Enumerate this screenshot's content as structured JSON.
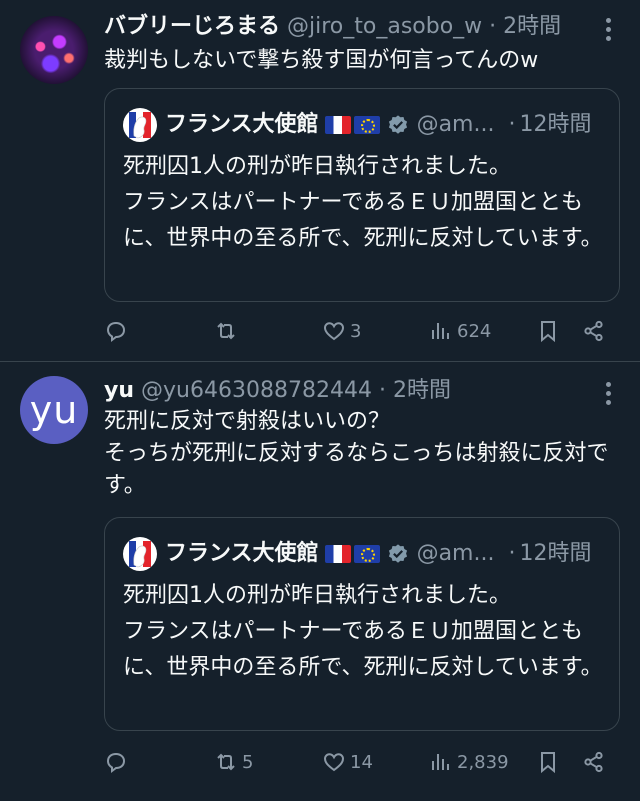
{
  "tweets": [
    {
      "display_name": "バブリーじろまる",
      "handle": "@jiro_to_asobo_w",
      "time": "2時間",
      "text": "裁判もしないで撃ち殺す国が何言ってんのw",
      "quote": {
        "name": "フランス大使館",
        "handle": "@am...",
        "time": "12時間",
        "text": "死刑囚1人の刑が昨日執行されました。\nフランスはパートナーであるＥＵ加盟国とともに、世界中の至る所で、死刑に反対しています。"
      },
      "replies": "",
      "retweets": "",
      "likes": "3",
      "views": "624"
    },
    {
      "avatar_text": "yu",
      "display_name": "yu",
      "handle": "@yu6463088782444",
      "time": "2時間",
      "text": "死刑に反対で射殺はいいの？\nそっちが死刑に反対するならこっちは射殺に反対です。",
      "quote": {
        "name": "フランス大使館",
        "handle": "@am...",
        "time": "12時間",
        "text": "死刑囚1人の刑が昨日執行されました。\nフランスはパートナーであるＥＵ加盟国とともに、世界中の至る所で、死刑に反対しています。"
      },
      "replies": "",
      "retweets": "5",
      "likes": "14",
      "views": "2,839"
    }
  ],
  "separator": "·",
  "icons": {
    "more": "more-dots-icon",
    "reply": "reply-icon",
    "retweet": "retweet-icon",
    "like": "heart-icon",
    "views": "views-chart-icon",
    "bookmark": "bookmark-icon",
    "share": "share-icon",
    "verified": "verified-badge-icon",
    "flags": [
      "france-flag-icon",
      "eu-flag-icon"
    ]
  },
  "colors": {
    "background": "#15202b",
    "text": "#f7f9f9",
    "secondary": "#8b98a5",
    "border": "#38444d",
    "verified_badge": "#829aab",
    "avatar_yu": "#5a5fc2"
  }
}
